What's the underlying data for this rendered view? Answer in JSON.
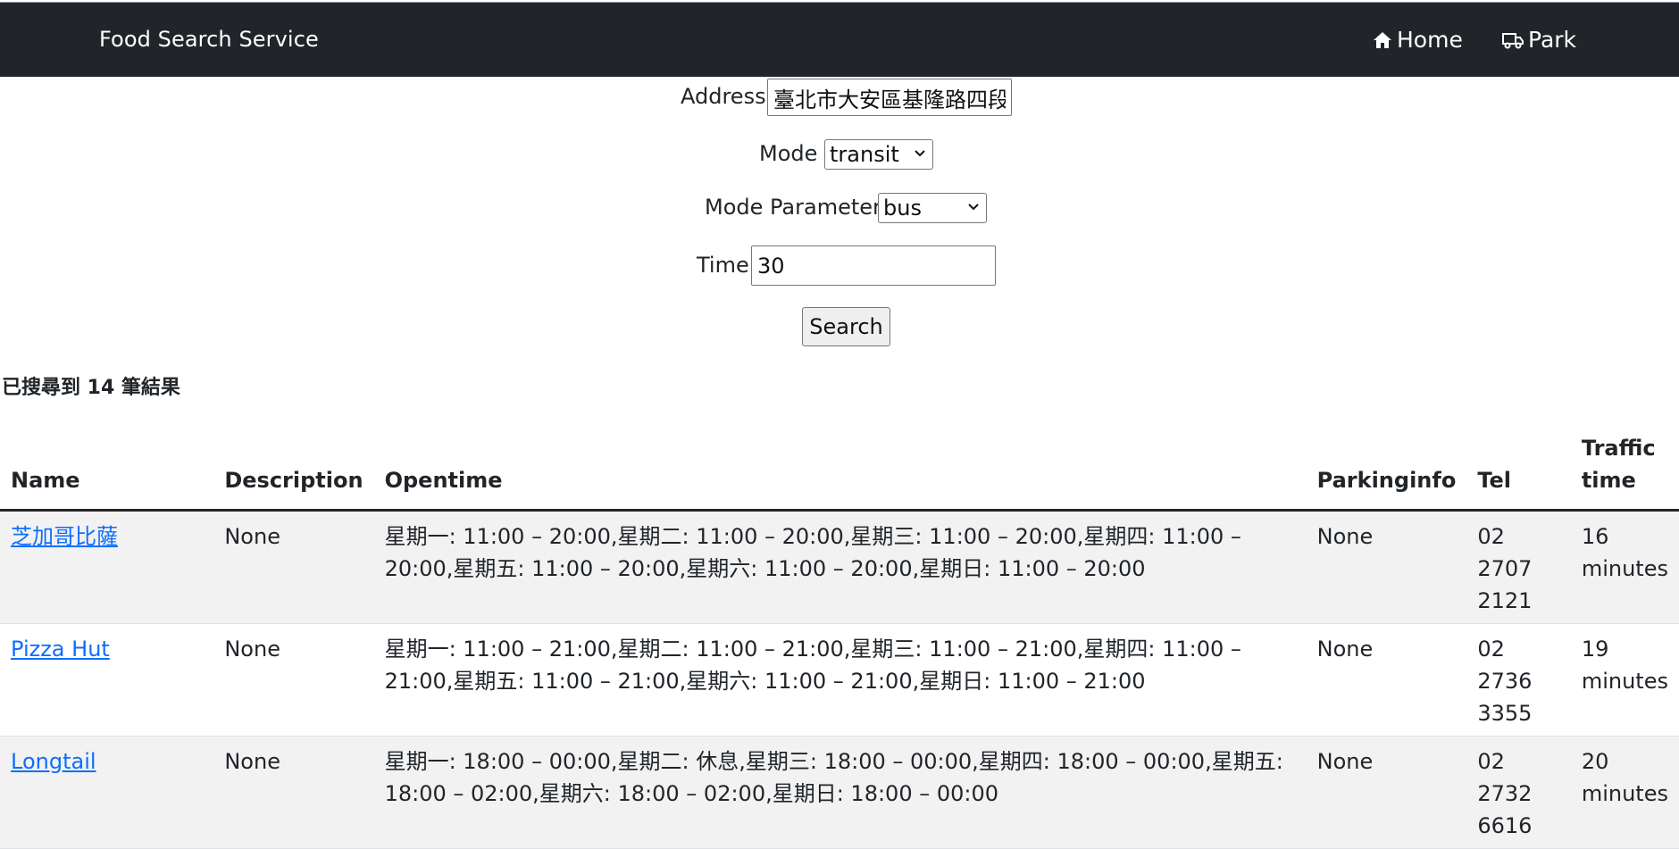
{
  "navbar": {
    "brand": "Food Search Service",
    "home_label": "Home",
    "park_label": "Park"
  },
  "form": {
    "address_label": "Address",
    "address_value": "臺北市大安區基隆路四段",
    "mode_label": "Mode",
    "mode_value": "transit",
    "param_label": "Mode Parameter",
    "param_value": "bus",
    "time_label": "Time",
    "time_value": "30",
    "search_label": "Search"
  },
  "results": {
    "count_text": "已搜尋到 14 筆結果",
    "headers": [
      "Name",
      "Description",
      "Opentime",
      "Parkinginfo",
      "Tel",
      "Traffic time"
    ],
    "rows": [
      {
        "name": "芝加哥比薩",
        "description": "None",
        "opentime": "星期一: 11:00 – 20:00,星期二: 11:00 – 20:00,星期三: 11:00 – 20:00,星期四: 11:00 – 20:00,星期五: 11:00 – 20:00,星期六: 11:00 – 20:00,星期日: 11:00 – 20:00",
        "parking": "None",
        "tel": "02 2707 2121",
        "traffic": "16 minutes"
      },
      {
        "name": "Pizza Hut",
        "description": "None",
        "opentime": "星期一: 11:00 – 21:00,星期二: 11:00 – 21:00,星期三: 11:00 – 21:00,星期四: 11:00 – 21:00,星期五: 11:00 – 21:00,星期六: 11:00 – 21:00,星期日: 11:00 – 21:00",
        "parking": "None",
        "tel": "02 2736 3355",
        "traffic": "19 minutes"
      },
      {
        "name": "Longtail",
        "description": "None",
        "opentime": "星期一: 18:00 – 00:00,星期二: 休息,星期三: 18:00 – 00:00,星期四: 18:00 – 00:00,星期五: 18:00 – 02:00,星期六: 18:00 – 02:00,星期日: 18:00 – 00:00",
        "parking": "None",
        "tel": "02 2732 6616",
        "traffic": "20 minutes"
      }
    ]
  }
}
